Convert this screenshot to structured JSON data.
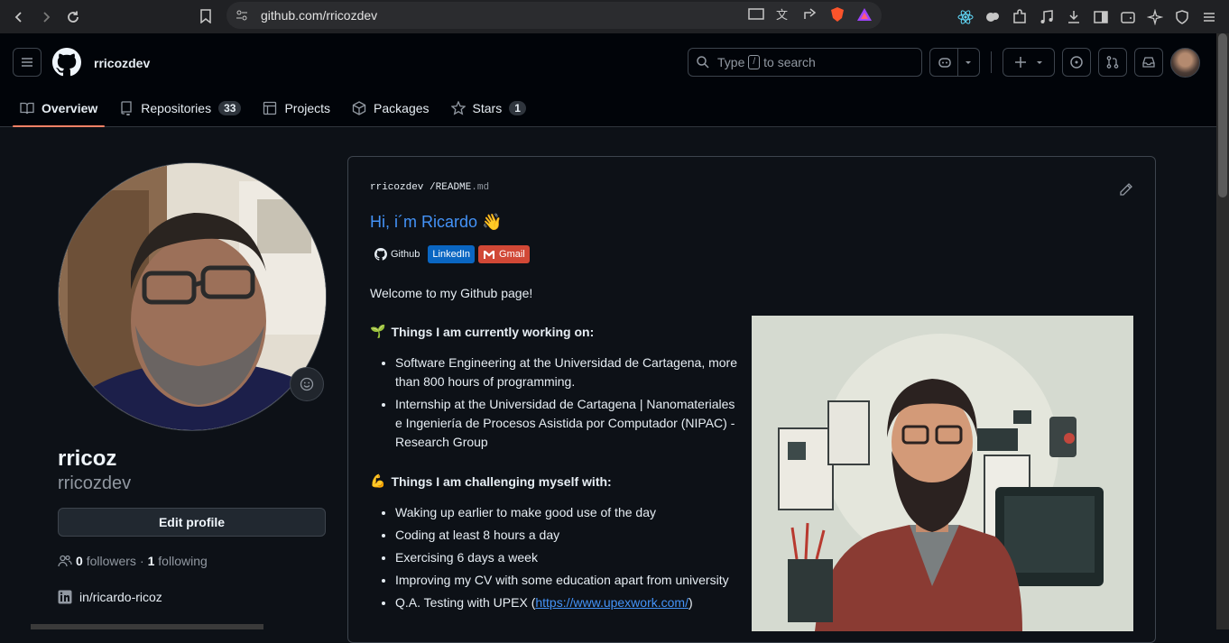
{
  "browser": {
    "url": "github.com/rricozdev"
  },
  "header": {
    "username": "rricozdev",
    "search_prefix": "Type",
    "search_key": "/",
    "search_suffix": "to search"
  },
  "tabs": [
    {
      "label": "Overview",
      "count": ""
    },
    {
      "label": "Repositories",
      "count": "33"
    },
    {
      "label": "Projects",
      "count": ""
    },
    {
      "label": "Packages",
      "count": ""
    },
    {
      "label": "Stars",
      "count": "1"
    }
  ],
  "profile": {
    "display_name": "rricoz",
    "login": "rricozdev",
    "edit_label": "Edit profile",
    "followers_count": "0",
    "followers_label": "followers",
    "sep": "·",
    "following_count": "1",
    "following_label": "following",
    "linkedin": "in/ricardo-ricoz"
  },
  "readme": {
    "path_user": "rricozdev",
    "path_sep": "/",
    "path_file": "README",
    "path_ext": ".md",
    "title": "Hi, i´m Ricardo 👋",
    "badges": {
      "github": "Github",
      "linkedin": "LinkedIn",
      "gmail": "Gmail"
    },
    "welcome": "Welcome to my Github page!",
    "section1_emoji": "🌱",
    "section1_title": "Things I am currently working on:",
    "section1_items": [
      "Software Engineering at the Universidad de Cartagena, more than 800 hours of programming.",
      "Internship at the Universidad de Cartagena | Nanomateriales e Ingeniería de Procesos Asistida por Computador (NIPAC) - Research Group"
    ],
    "section2_emoji": "💪",
    "section2_title": "Things I am challenging myself with:",
    "section2_items": [
      "Waking up earlier to make good use of the day",
      "Coding at least 8 hours a day",
      "Exercising 6 days a week",
      "Improving my CV with some education apart from university"
    ],
    "upex_prefix": "Q.A. Testing with UPEX (",
    "upex_link": "https://www.upexwork.com/",
    "upex_suffix": ")"
  },
  "colors": {
    "accent_link": "#4493f8",
    "tab_underline": "#f78166",
    "linkedin_badge": "#0a66c2",
    "gmail_badge": "#d14836"
  }
}
